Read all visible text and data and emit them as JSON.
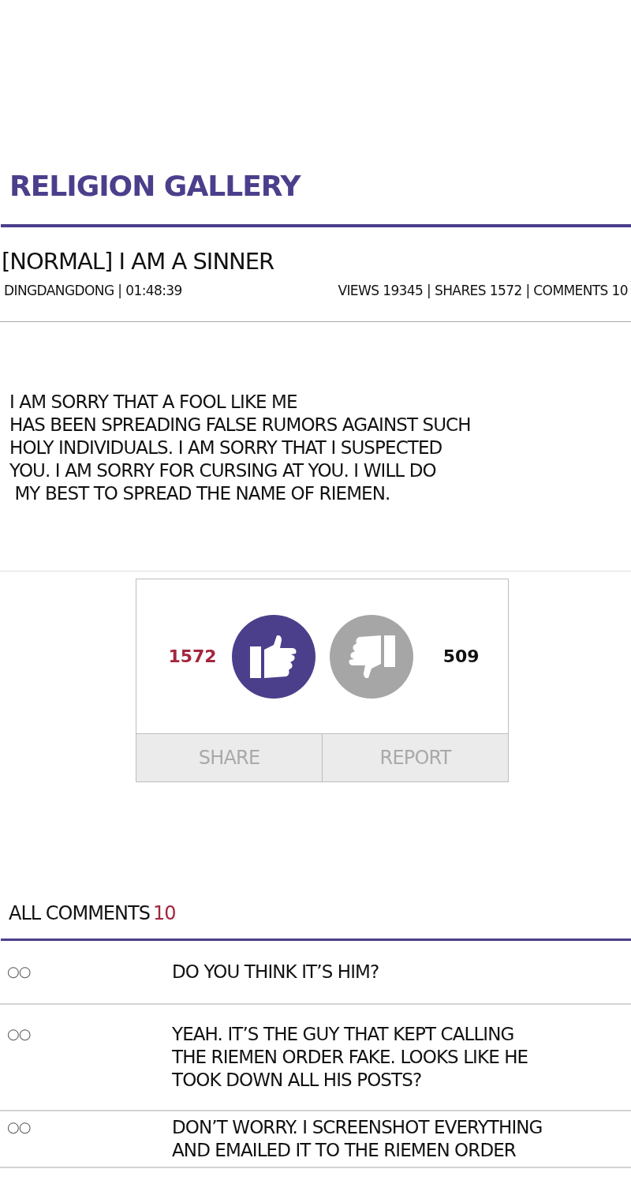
{
  "gallery": {
    "title": "RELIGION GALLERY"
  },
  "post": {
    "title": "[NORMAL] I AM A SINNER",
    "byline": "DINGDANGDONG | 01:48:39",
    "stats": "VIEWS 19345 | SHARES 1572 | COMMENTS 10",
    "body": "I AM SORRY THAT A FOOL LIKE ME\nHAS BEEN SPREADING FALSE RUMORS AGAINST SUCH\nHOLY INDIVIDUALS. I AM SORRY THAT I SUSPECTED\nYOU. I AM SORRY FOR CURSING AT YOU. I WILL DO\n MY BEST TO SPREAD THE NAME OF RIEMEN."
  },
  "votes": [
    {
      "kind": "up",
      "count": "1572",
      "selected": true
    },
    {
      "kind": "down",
      "count": "509",
      "selected": false
    }
  ],
  "actions": [
    "SHARE",
    "REPORT"
  ],
  "comments": {
    "title": "ALL COMMENTS",
    "count": "10",
    "items": [
      {
        "author": "○○",
        "text": "DO YOU THINK IT’S HIM?"
      },
      {
        "author": "○○",
        "text": "YEAH. IT’S THE GUY THAT KEPT CALLING\nTHE RIEMEN ORDER FAKE. LOOKS LIKE HE\nTOOK DOWN ALL HIS POSTS?"
      },
      {
        "author": "○○",
        "text": "DON’T WORRY. I SCREENSHOT EVERYTHING\nAND EMAILED IT TO THE RIEMEN ORDER"
      }
    ]
  }
}
